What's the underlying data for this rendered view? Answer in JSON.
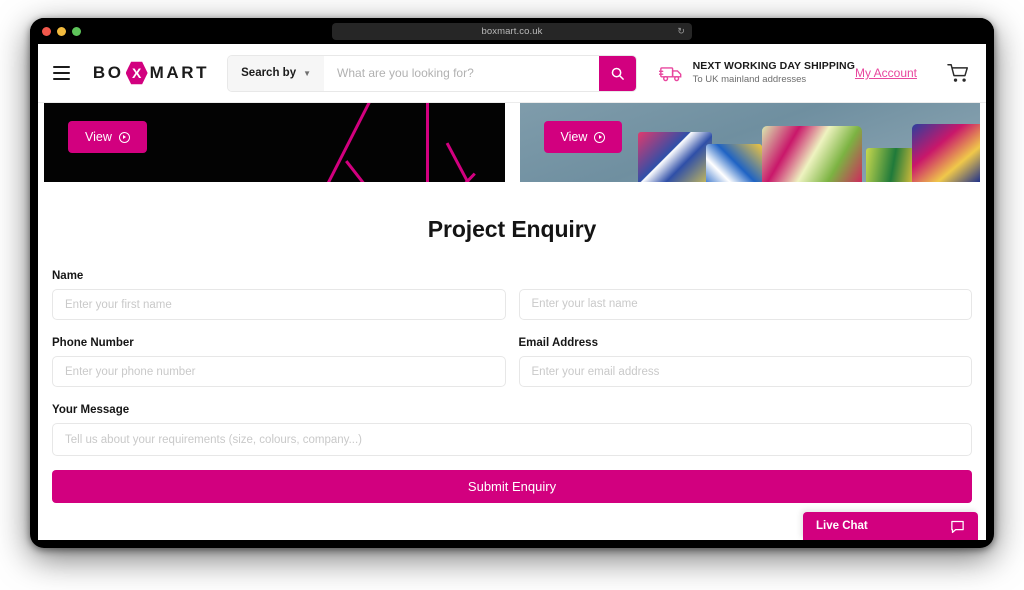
{
  "browser": {
    "url": "boxmart.co.uk",
    "reload_icon": "reload-icon",
    "traffic_lights": [
      "close-dot",
      "minimize-dot",
      "maximize-dot"
    ]
  },
  "header": {
    "menu_icon": "hamburger-icon",
    "logo": {
      "part1": "BO",
      "mark": "X",
      "part2": "MART"
    },
    "search": {
      "dropdown_label": "Search by",
      "chevron": "⌄",
      "placeholder": "What are you looking for?",
      "value": "",
      "button_icon": "search-icon"
    },
    "shipping": {
      "icon": "delivery-truck-icon",
      "line1": "NEXT WORKING DAY SHIPPING",
      "line2": "To UK mainland addresses"
    },
    "account_link": "My Account",
    "cart_icon": "shopping-cart-icon"
  },
  "banners": [
    {
      "name": "banner-left",
      "view_label": "View"
    },
    {
      "name": "banner-right",
      "view_label": "View"
    }
  ],
  "form": {
    "title": "Project Enquiry",
    "labels": {
      "name": "Name",
      "phone": "Phone Number",
      "email": "Email Address",
      "message": "Your Message"
    },
    "placeholders": {
      "first_name": "Enter your first name",
      "last_name": "Enter your last name",
      "phone": "Enter your phone number",
      "email": "Enter your email address",
      "message": "Tell us about your requirements (size, colours, company...)"
    },
    "values": {
      "first_name": "",
      "last_name": "",
      "phone": "",
      "email": "",
      "message": ""
    },
    "submit_label": "Submit Enquiry"
  },
  "live_chat": {
    "label": "Live Chat",
    "icon": "chat-bubble-icon"
  },
  "colors": {
    "brand_magenta": "#d2007f",
    "link_pink": "#e8469e",
    "banner_black": "#030303",
    "text_dark": "#141414"
  }
}
